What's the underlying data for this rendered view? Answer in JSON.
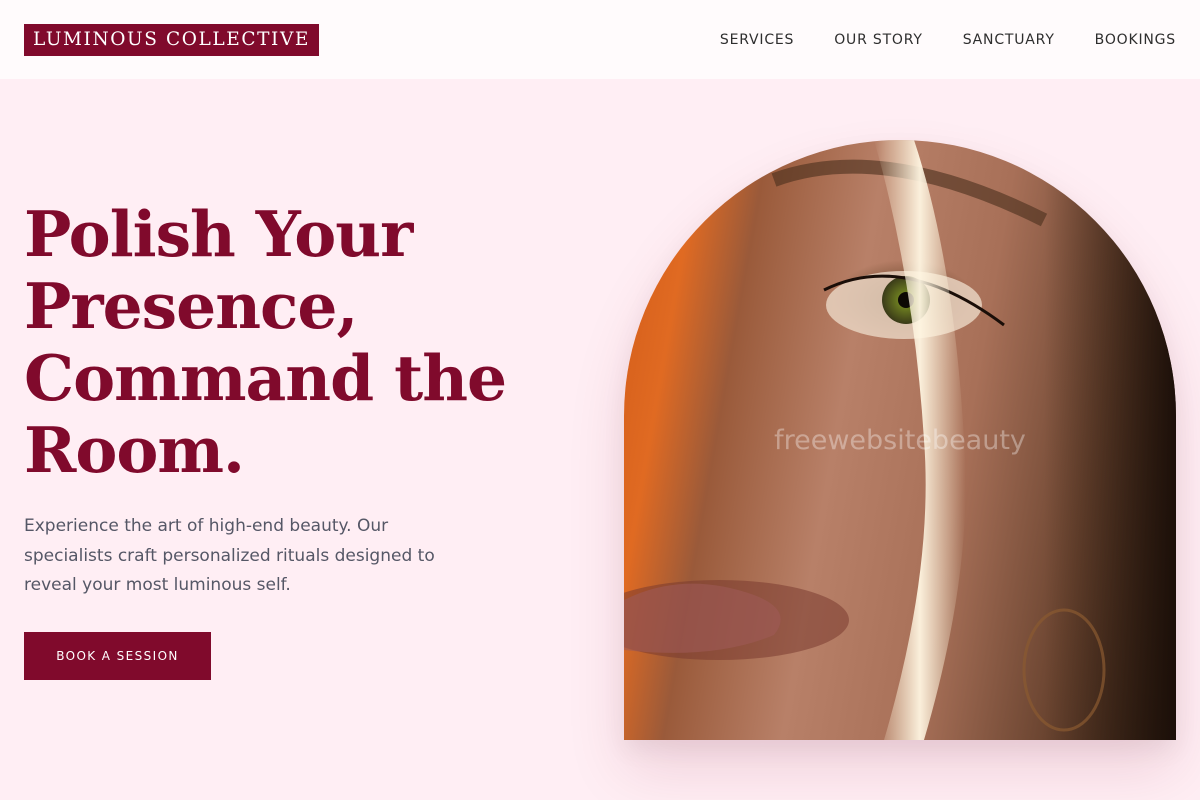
{
  "brand": {
    "logo_text": "LUMINOUS COLLECTIVE",
    "accent_color": "#800a2c",
    "background_color": "#ffeef4"
  },
  "nav": {
    "items": [
      {
        "label": "SERVICES"
      },
      {
        "label": "OUR STORY"
      },
      {
        "label": "SANCTUARY"
      },
      {
        "label": "BOOKINGS"
      }
    ]
  },
  "hero": {
    "headline_lines": [
      "Polish Your",
      "Presence,",
      "Command the",
      "Room."
    ],
    "lede": "Experience the art of high-end beauty. Our specialists craft personalized rituals designed to reveal your most luminous self.",
    "cta_label": "BOOK A SESSION",
    "image_watermark": "freewebsitebeauty"
  }
}
